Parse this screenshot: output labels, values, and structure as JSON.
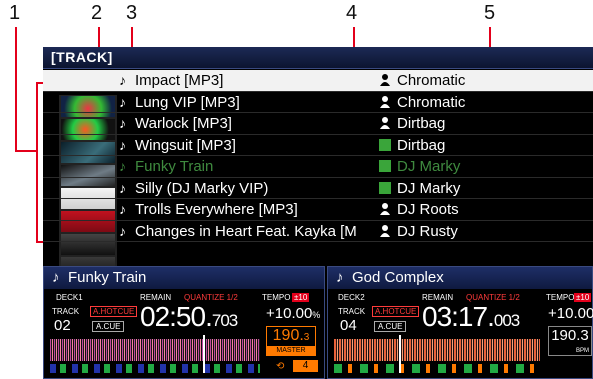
{
  "callouts": [
    "1",
    "2",
    "3",
    "4",
    "5"
  ],
  "header": {
    "title": "[TRACK]"
  },
  "tracks": [
    {
      "title": "Impact [MP3]",
      "artist": "Chromatic",
      "artist_icon": "person-icon",
      "selected": true,
      "playing": false
    },
    {
      "title": "Lung VIP [MP3]",
      "artist": "Chromatic",
      "artist_icon": "person-icon",
      "selected": false,
      "playing": false
    },
    {
      "title": "Warlock [MP3]",
      "artist": "Dirtbag",
      "artist_icon": "person-icon",
      "selected": false,
      "playing": false
    },
    {
      "title": "Wingsuit [MP3]",
      "artist": "Dirtbag",
      "artist_icon": "book-icon",
      "selected": false,
      "playing": false
    },
    {
      "title": "Funky Train",
      "artist": "DJ Marky",
      "artist_icon": "book-icon",
      "selected": false,
      "playing": true
    },
    {
      "title": "Silly (DJ Marky VIP)",
      "artist": "DJ Marky",
      "artist_icon": "book-icon",
      "selected": false,
      "playing": false
    },
    {
      "title": "Trolls Everywhere [MP3]",
      "artist": "DJ Roots",
      "artist_icon": "person-icon",
      "selected": false,
      "playing": false
    },
    {
      "title": "Changes in Heart Feat. Kayka [M",
      "artist": "DJ Rusty",
      "artist_icon": "person-icon",
      "selected": false,
      "playing": false
    }
  ],
  "decks": [
    {
      "title": "Funky Train",
      "deck_label": "DECK1",
      "track_label": "TRACK",
      "track_no": "02",
      "hotcue": "A.HOTCUE",
      "acue": "A.CUE",
      "remain_label": "REMAIN",
      "time_main": "02:50.",
      "time_ms": "703",
      "quantize": "QUANTIZE 1/2",
      "tempo_label": "TEMPO",
      "tempo_range": "±10",
      "tempo": "+10.00",
      "tempo_unit": "%",
      "bpm": "190.",
      "bpm_dec": "3",
      "bpm_label": "MASTER",
      "loop_beats": "4"
    },
    {
      "title": "God Complex",
      "deck_label": "DECK2",
      "track_label": "TRACK",
      "track_no": "04",
      "hotcue": "A.HOTCUE",
      "acue": "A.CUE",
      "remain_label": "REMAIN",
      "time_main": "03:17.",
      "time_ms": "003",
      "quantize": "QUANTIZE 1/2",
      "tempo_label": "TEMPO",
      "tempo_range": "±10",
      "tempo": "+10.00",
      "bpm": "190.3",
      "bpm_label": "BPM"
    }
  ],
  "colors": {
    "accent_orange": "#ff7a00",
    "callout_line": "#e3001b",
    "playing_green": "#3f8a3f",
    "header_blue": "#1c2a55"
  }
}
